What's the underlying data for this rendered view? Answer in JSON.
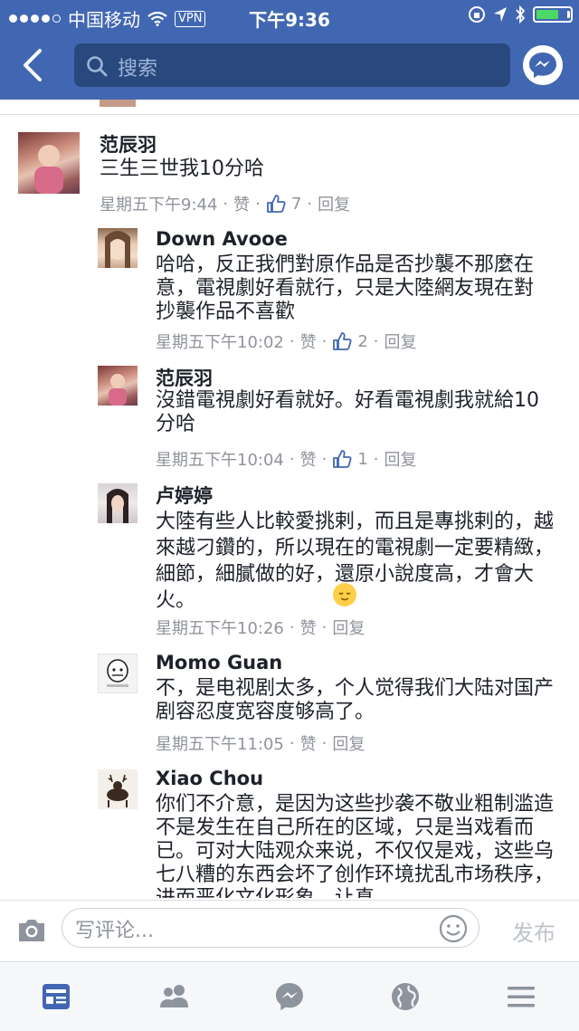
{
  "status_bar": {
    "carrier": "中国移动",
    "vpn": "VPN",
    "time": "下午9:36"
  },
  "header": {
    "search_placeholder": "搜索"
  },
  "comments": [
    {
      "name": "范辰羽",
      "text": "三生三世我10分哈",
      "time": "星期五下午9:44",
      "like": "赞",
      "like_count": "7",
      "reply": "回复"
    },
    {
      "name": "Down Avooe",
      "text": "哈哈，反正我們對原作品是否抄襲不那麼在意，電視劇好看就行，只是大陸網友現在對抄襲作品不喜歡",
      "time": "星期五下午10:02",
      "like": "赞",
      "like_count": "2",
      "reply": "回复"
    },
    {
      "name": "范辰羽",
      "text": "沒錯電視劇好看就好。好看電視劇我就給10分哈",
      "time": "星期五下午10:04",
      "like": "赞",
      "like_count": "1",
      "reply": "回复"
    },
    {
      "name": "卢婷婷",
      "text": "大陸有些人比較愛挑剌，而且是專挑剌的，越來越刁鑽的，所以現在的電視劇一定要精緻，細節，細膩做的好，還原小說度高，才會大火。",
      "time": "星期五下午10:26",
      "like": "赞",
      "reply": "回复"
    },
    {
      "name": "Momo Guan",
      "text": "不，是电视剧太多，个人觉得我们大陆对国产剧容忍度宽容度够高了。",
      "time": "星期五下午11:05",
      "like": "赞",
      "reply": "回复"
    },
    {
      "name": "Xiao Chou",
      "text": "你们不介意，是因为这些抄袭不敬业粗制滥造不是发生在自己所在的区域，只是当戏看而已。可对大陆观众来说，不仅仅是戏，这些乌七八糟的东西会坏了创作环境扰乱市场秩序，进而恶化文化形象，让真"
    }
  ],
  "composer": {
    "placeholder": "写评论...",
    "post_label": "发布"
  },
  "tabbar": {
    "items": [
      "news-feed",
      "friends",
      "messenger",
      "notifications",
      "menu"
    ]
  },
  "colors": {
    "brand": "#4267b2",
    "search_bg": "#29487d",
    "meta_text": "#90949c",
    "battery": "#4cd964",
    "link": "#4267b2"
  }
}
